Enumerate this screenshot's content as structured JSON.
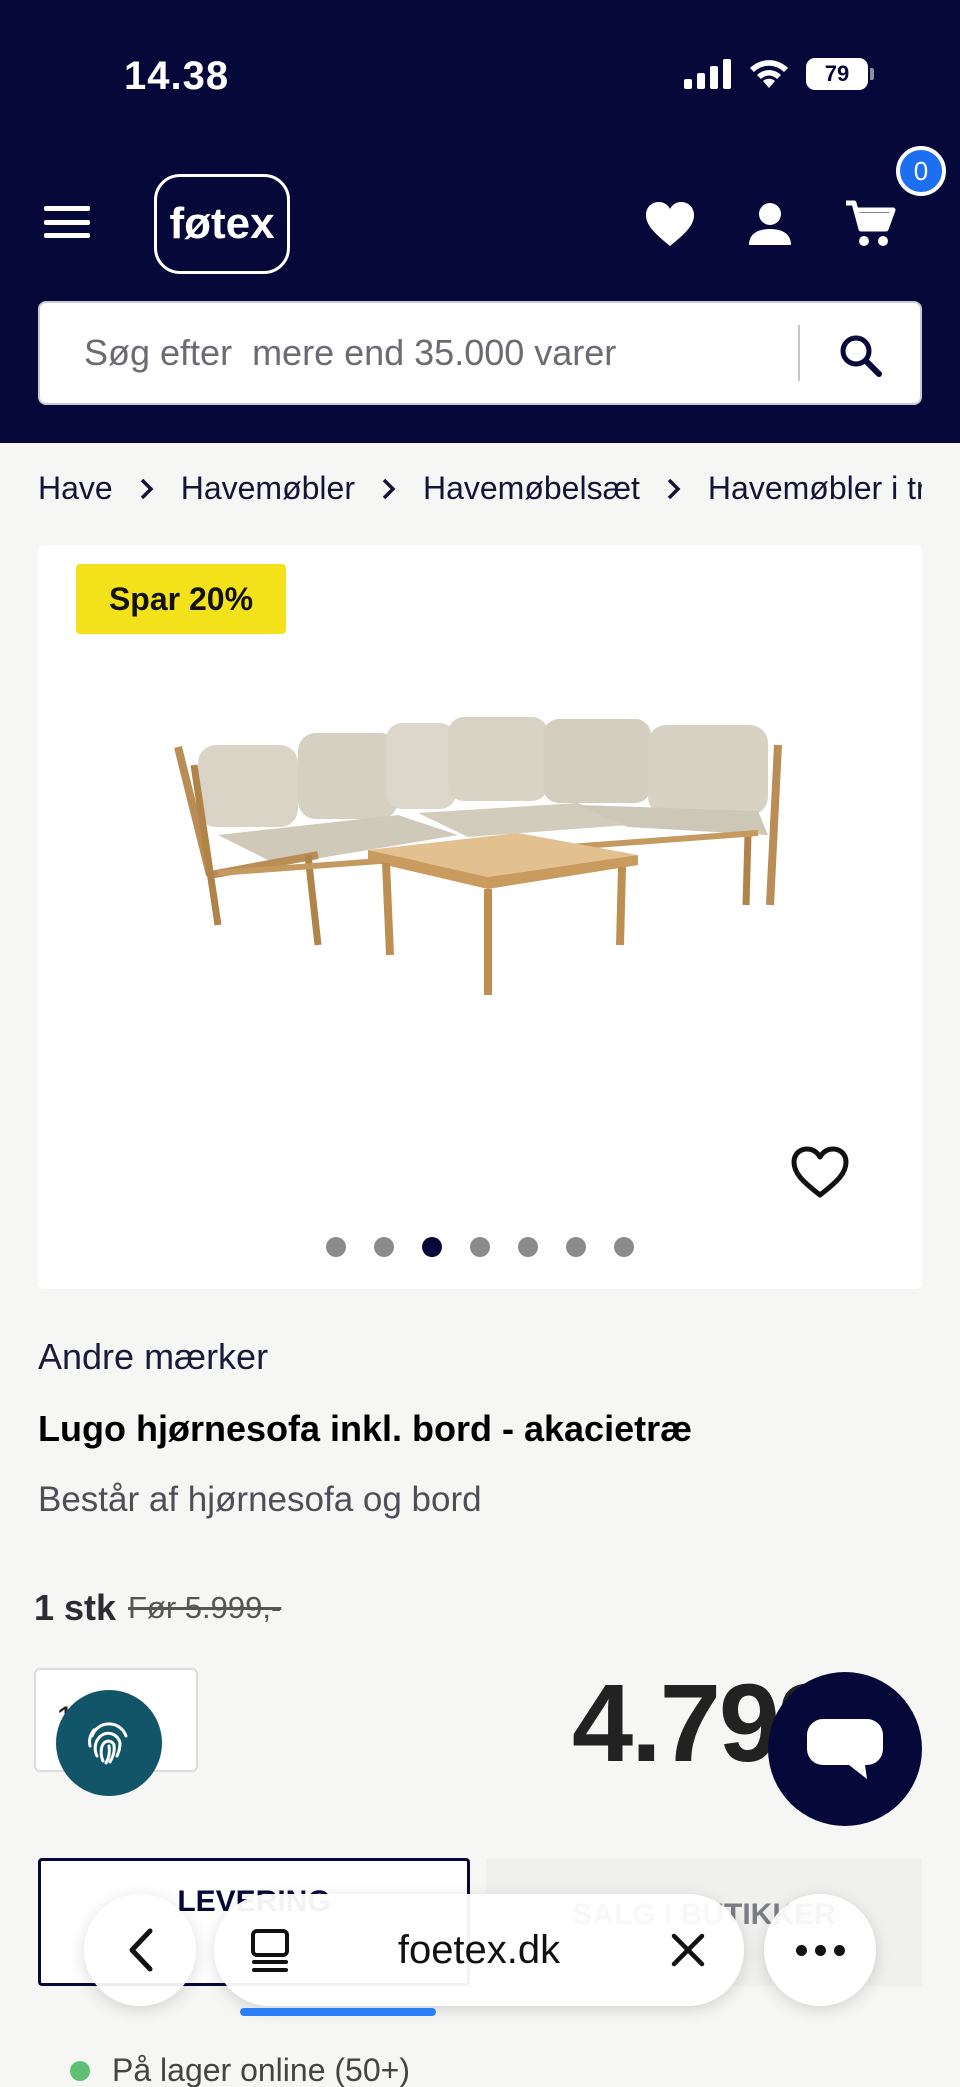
{
  "status_bar": {
    "time": "14.38",
    "battery": "79"
  },
  "header": {
    "logo": "føtex",
    "cart_count": "0",
    "icons": [
      "menu-icon",
      "heart-icon",
      "user-icon",
      "cart-icon"
    ]
  },
  "search": {
    "placeholder": "Søg efter  mere end 35.000 varer"
  },
  "breadcrumb": [
    "Have",
    "Havemøbler",
    "Havemøbelsæt",
    "Havemøbler i træ"
  ],
  "product": {
    "badge": "Spar 20%",
    "image_count": 7,
    "active_image": 3,
    "brand": "Andre mærker",
    "title": "Lugo hjørnesofa inkl. bord - akacietræ",
    "subtitle": "Består af hjørnesofa og bord",
    "unit": "1 stk",
    "before_price": "Før 5.999,-",
    "quantity": "1",
    "price": "4.799,-"
  },
  "delivery_tabs": {
    "delivery": "LEVERING",
    "store": "SALG I BUTIKKER"
  },
  "stock": "På lager online (50+)",
  "browser": {
    "domain": "foetex.dk"
  },
  "colors": {
    "header_bg": "#07083a",
    "badge": "#f3e219",
    "accent": "#1d6ff2",
    "in_stock": "#5fc075"
  }
}
